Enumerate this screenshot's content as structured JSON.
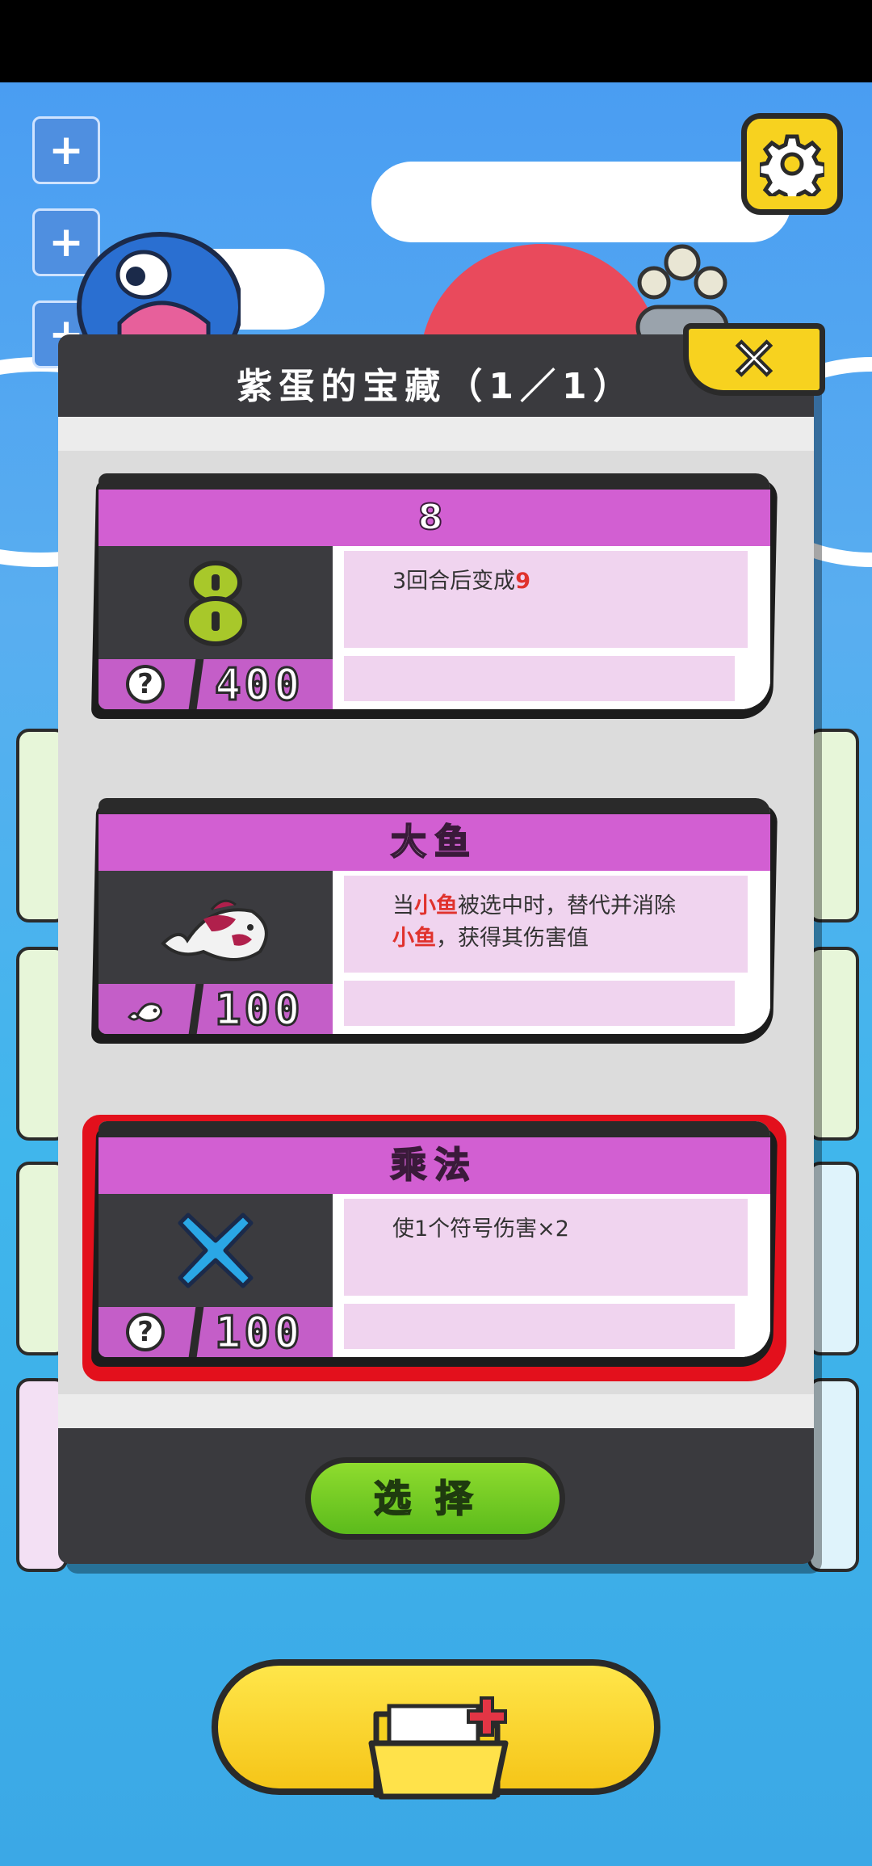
{
  "modal": {
    "title": "紫蛋的宝藏（1／1）",
    "close_symbol": "✕",
    "select_label": "选择"
  },
  "cards": [
    {
      "title": "8",
      "icon": "number-8-icon",
      "footer_icon": "question-icon",
      "value": "400",
      "description_parts": [
        {
          "text": "3回合后变成",
          "highlight": false
        },
        {
          "text": "9",
          "highlight": true
        }
      ],
      "selected": false
    },
    {
      "title": "大鱼",
      "icon": "big-fish-icon",
      "footer_icon": "fish-icon",
      "value": "100",
      "description_line1": [
        {
          "text": "当",
          "highlight": false
        },
        {
          "text": "小鱼",
          "highlight": true
        },
        {
          "text": "被选中时，替代并消除",
          "highlight": false
        }
      ],
      "description_line2": [
        {
          "text": "小鱼",
          "highlight": true
        },
        {
          "text": "，获得其伤害值",
          "highlight": false
        }
      ],
      "selected": false
    },
    {
      "title": "乘法",
      "icon": "multiply-icon",
      "footer_icon": "question-icon",
      "value": "100",
      "description_parts": [
        {
          "text": "使1个符号伤害×2",
          "highlight": false
        }
      ],
      "selected": true
    }
  ],
  "colors": {
    "sky": "#4a9df2",
    "card_header": "#d25fd2",
    "highlight": "#e0322d",
    "select_button": "#6cc81f",
    "yellow_button": "#f7d21f",
    "selected_border": "#e3101c"
  },
  "hud": {
    "side_button_icon": "plus-icon",
    "settings_icon": "gear-icon",
    "bottom_button_icon": "folder-add-icon"
  }
}
